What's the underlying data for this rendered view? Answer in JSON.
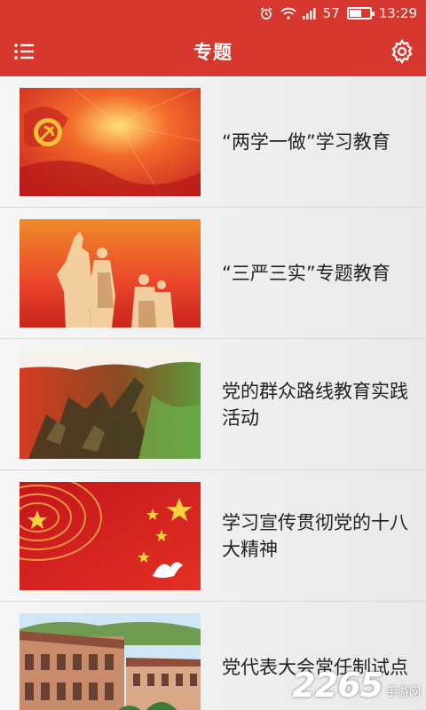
{
  "status_bar": {
    "signal_level": "57",
    "time": "13:29",
    "battery_level": 0.57,
    "icons": [
      "alarm-icon",
      "wifi-icon",
      "signal-icon",
      "battery-icon"
    ]
  },
  "app_bar": {
    "title": "专题",
    "menu_icon": "menu-icon",
    "settings_icon": "gear-icon",
    "color": "#d6372e"
  },
  "topics": [
    {
      "title": "“两学一做”学习教育"
    },
    {
      "title": "“三严三实”专题教育"
    },
    {
      "title": "党的群众路线教育实践活动"
    },
    {
      "title": "学习宣传贯彻党的十八大精神"
    },
    {
      "title": "党代表大会常任制试点"
    }
  ],
  "watermark": {
    "number": "2265",
    "suffix": "手游网"
  }
}
